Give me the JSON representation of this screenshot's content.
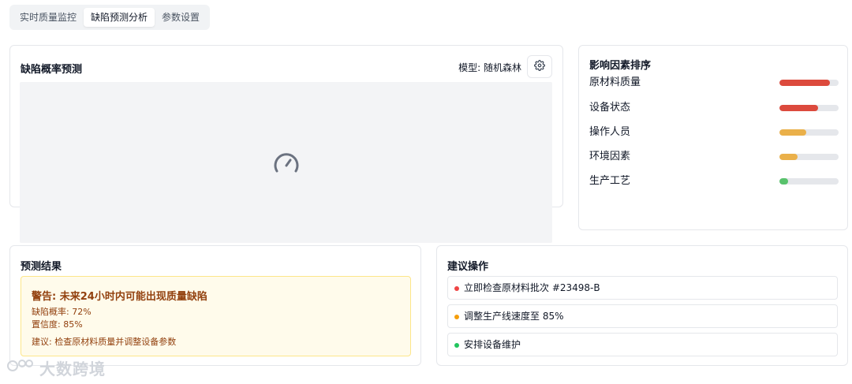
{
  "tabs": [
    {
      "label": "实时质量监控",
      "active": false
    },
    {
      "label": "缺陷预测分析",
      "active": true
    },
    {
      "label": "参数设置",
      "active": false
    }
  ],
  "prediction_card": {
    "title": "缺陷概率预测",
    "model_label": "模型: 随机森林",
    "settings_icon": "gear-icon",
    "loading_icon": "gauge-icon"
  },
  "factors_card": {
    "title": "影响因素排序",
    "items": [
      {
        "label": "原材料质量",
        "level": 0.85,
        "color": "#dc4a3d"
      },
      {
        "label": "设备状态",
        "level": 0.65,
        "color": "#dc4a3d"
      },
      {
        "label": "操作人员",
        "level": 0.45,
        "color": "#eab04a"
      },
      {
        "label": "环境因素",
        "level": 0.3,
        "color": "#eab04a"
      },
      {
        "label": "生产工艺",
        "level": 0.15,
        "color": "#58c26c"
      }
    ]
  },
  "result_card": {
    "title": "预测结果",
    "warning_title": "警告: 未来24小时内可能出现质量缺陷",
    "probability": "缺陷概率: 72%",
    "confidence": "置信度: 85%",
    "suggestion": "建议: 检查原材料质量并调整设备参数"
  },
  "actions_card": {
    "title": "建议操作",
    "items": [
      {
        "text": "立即检查原材料批次 #23498-B",
        "color": "#ef4444"
      },
      {
        "text": "调整生产线速度至 85%",
        "color": "#f59e0b"
      },
      {
        "text": "安排设备维护",
        "color": "#22c55e"
      }
    ]
  },
  "watermark": {
    "text": "大数跨境"
  }
}
